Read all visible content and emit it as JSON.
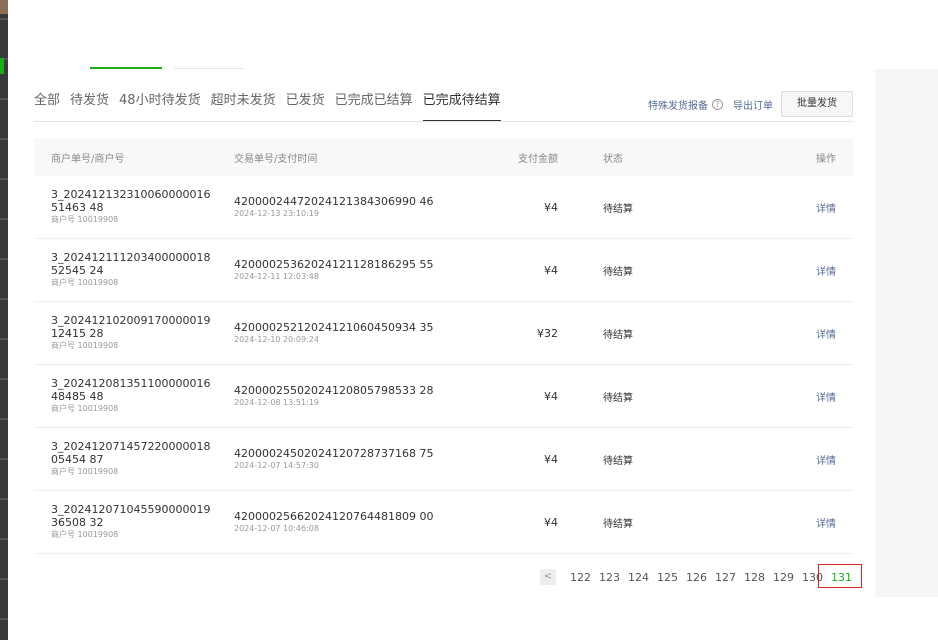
{
  "tabs": [
    "全部",
    "待发货",
    "48小时待发货",
    "超时未发货",
    "已发货",
    "已完成已结算",
    "已完成待结算"
  ],
  "active_tab": "已完成待结算",
  "actions": {
    "report_label": "特殊发货报备",
    "help_symbol": "?",
    "export_label": "导出订单",
    "batch_ship_label": "批量发货"
  },
  "table": {
    "headers": {
      "order": "商户单号/商户号",
      "transaction": "交易单号/支付时间",
      "amount": "支付金额",
      "status": "状态",
      "action": "操作"
    },
    "rows": [
      {
        "order_no": "3_20241213231006000001651463 48",
        "merchant": "商户号 10019908",
        "tx_no": "42000024472024121384306990 46",
        "tx_time": "2024-12-13 23:10:19",
        "amount": "¥4",
        "status": "待结算",
        "action": "详情"
      },
      {
        "order_no": "3_20241211120340000001852545 24",
        "merchant": "商户号 10019908",
        "tx_no": "42000025362024121128186295 55",
        "tx_time": "2024-12-11 12:03:48",
        "amount": "¥4",
        "status": "待结算",
        "action": "详情"
      },
      {
        "order_no": "3_20241210200917000001912415 28",
        "merchant": "商户号 10019908",
        "tx_no": "42000025212024121060450934 35",
        "tx_time": "2024-12-10 20:09:24",
        "amount": "¥32",
        "status": "待结算",
        "action": "详情"
      },
      {
        "order_no": "3_20241208135110000001648485 48",
        "merchant": "商户号 10019908",
        "tx_no": "42000025502024120805798533 28",
        "tx_time": "2024-12-08 13:51:19",
        "amount": "¥4",
        "status": "待结算",
        "action": "详情"
      },
      {
        "order_no": "3_20241207145722000001805454 87",
        "merchant": "商户号 10019908",
        "tx_no": "42000024502024120728737168 75",
        "tx_time": "2024-12-07 14:57:30",
        "amount": "¥4",
        "status": "待结算",
        "action": "详情"
      },
      {
        "order_no": "3_20241207104559000001936508 32",
        "merchant": "商户号 10019908",
        "tx_no": "42000025662024120764481809 00",
        "tx_time": "2024-12-07 10:46:08",
        "amount": "¥4",
        "status": "待结算",
        "action": "详情"
      }
    ]
  },
  "pagination": {
    "prev_symbol": "<",
    "pages": [
      "122",
      "123",
      "124",
      "125",
      "126",
      "127",
      "128",
      "129",
      "130",
      "131"
    ],
    "current": "131"
  }
}
